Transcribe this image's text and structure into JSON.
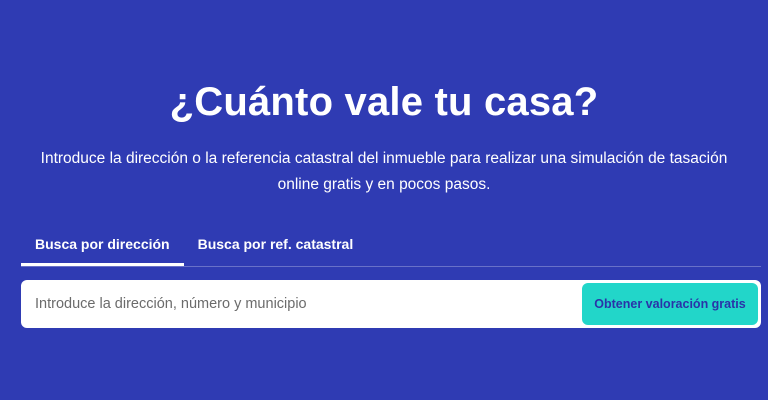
{
  "hero": {
    "title": "¿Cuánto vale tu casa?",
    "subtitle": "Introduce la dirección o la referencia catastral del inmueble para realizar una simulación de tasación online gratis y en pocos pasos."
  },
  "tabs": [
    {
      "label": "Busca por dirección",
      "active": true
    },
    {
      "label": "Busca por ref. catastral",
      "active": false
    }
  ],
  "search": {
    "placeholder": "Introduce la dirección, número y municipio",
    "value": "",
    "button_label": "Obtener valoración gratis"
  },
  "colors": {
    "background": "#2f3bb3",
    "button": "#22d6c9",
    "button_text": "#2a33a8",
    "text": "#ffffff"
  }
}
